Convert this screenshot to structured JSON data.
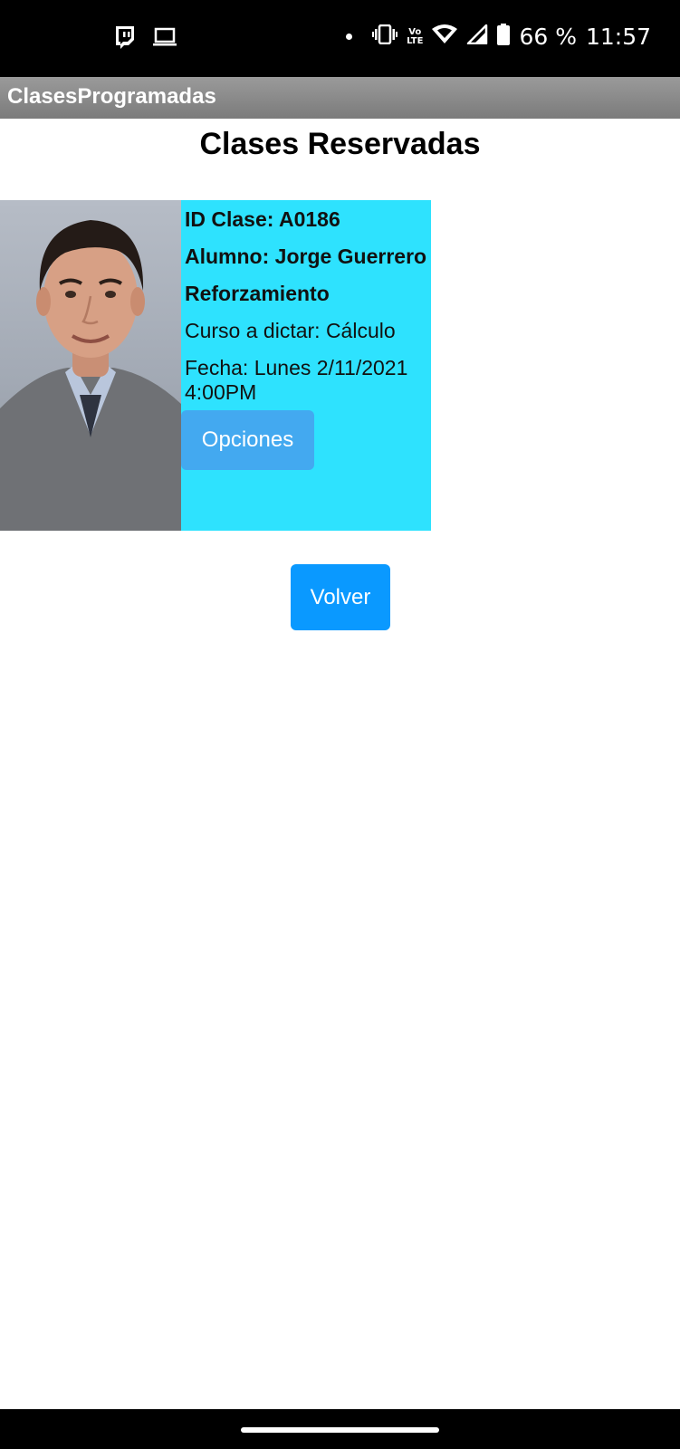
{
  "status_bar": {
    "left_icons": [
      "twitch-icon",
      "laptop-icon"
    ],
    "right_icons": [
      "notification-dot-icon",
      "vibrate-icon",
      "volte-icon",
      "wifi-icon",
      "signal-icon",
      "battery-icon"
    ],
    "volte_label_top": "Vo",
    "volte_label_bottom": "LTE",
    "battery": "66 %",
    "time": "11:57"
  },
  "app_bar": {
    "title": "ClasesProgramadas"
  },
  "page": {
    "title": "Clases Reservadas"
  },
  "card": {
    "photo": "student-photo",
    "id_line": "ID Clase: A0186",
    "student_line": "Alumno: Jorge Guerrero",
    "type_line": "Reforzamiento",
    "course_line": "Curso a dictar: Cálculo",
    "date_line_1": "Fecha: Lunes 2/11/2021",
    "date_line_2": "4:00PM",
    "options_label": "Opciones"
  },
  "actions": {
    "back_label": "Volver"
  },
  "colors": {
    "card_background": "#2ee2fe",
    "options_button": "#43a9f0",
    "back_button": "#0a99ff",
    "app_bar": "#8a8a8a"
  }
}
